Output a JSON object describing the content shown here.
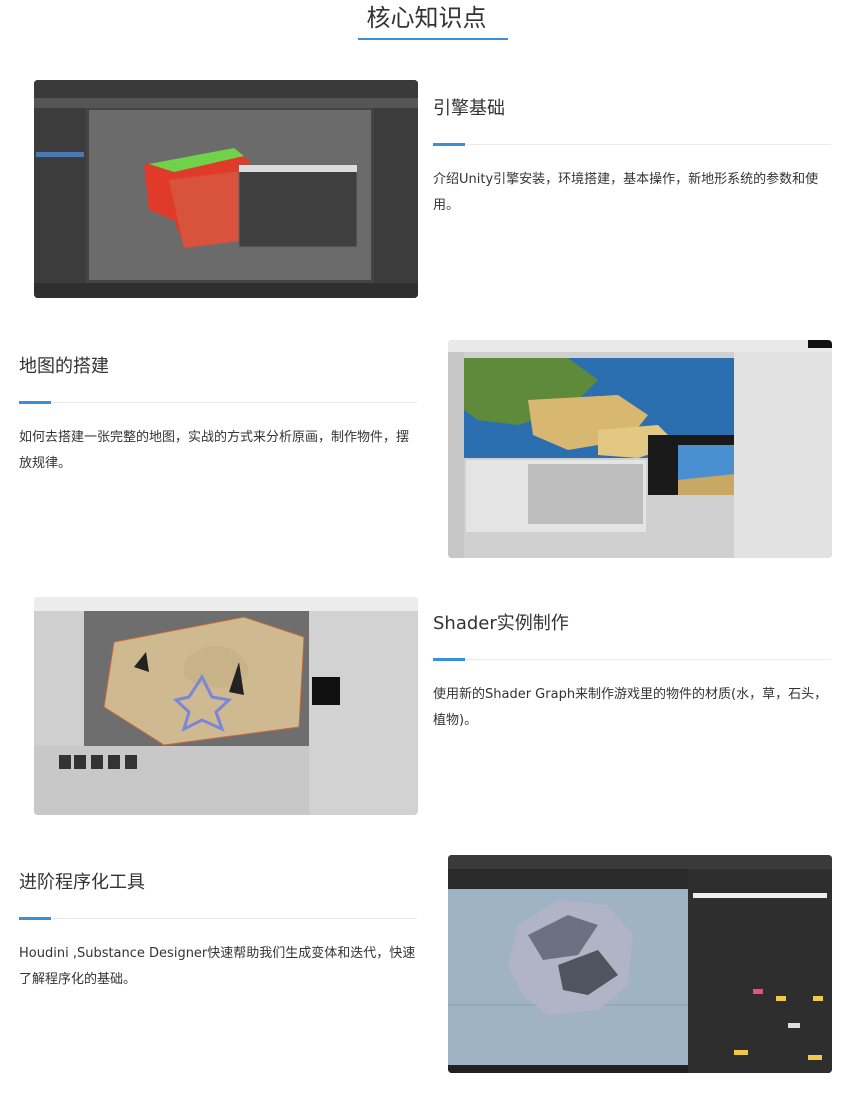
{
  "page": {
    "title": "核心知识点"
  },
  "sections": [
    {
      "heading": "引擎基础",
      "desc": "介绍Unity引擎安装，环境搭建，基本操作，新地形系统的参数和使用。"
    },
    {
      "heading": "地图的搭建",
      "desc": "如何去搭建一张完整的地图，实战的方式来分析原画，制作物件，摆放规律。"
    },
    {
      "heading": "Shader实例制作",
      "desc": "使用新的Shader Graph来制作游戏里的物件的材质(水，草，石头，植物)。"
    },
    {
      "heading": "进阶程序化工具",
      "desc": "Houdini ,Substance Designer快速帮助我们生成变体和迭代，快速了解程序化的基础。"
    }
  ],
  "colors": {
    "accent": "#3b8ed8",
    "divider": "#eaeaea",
    "text": "#333333"
  }
}
